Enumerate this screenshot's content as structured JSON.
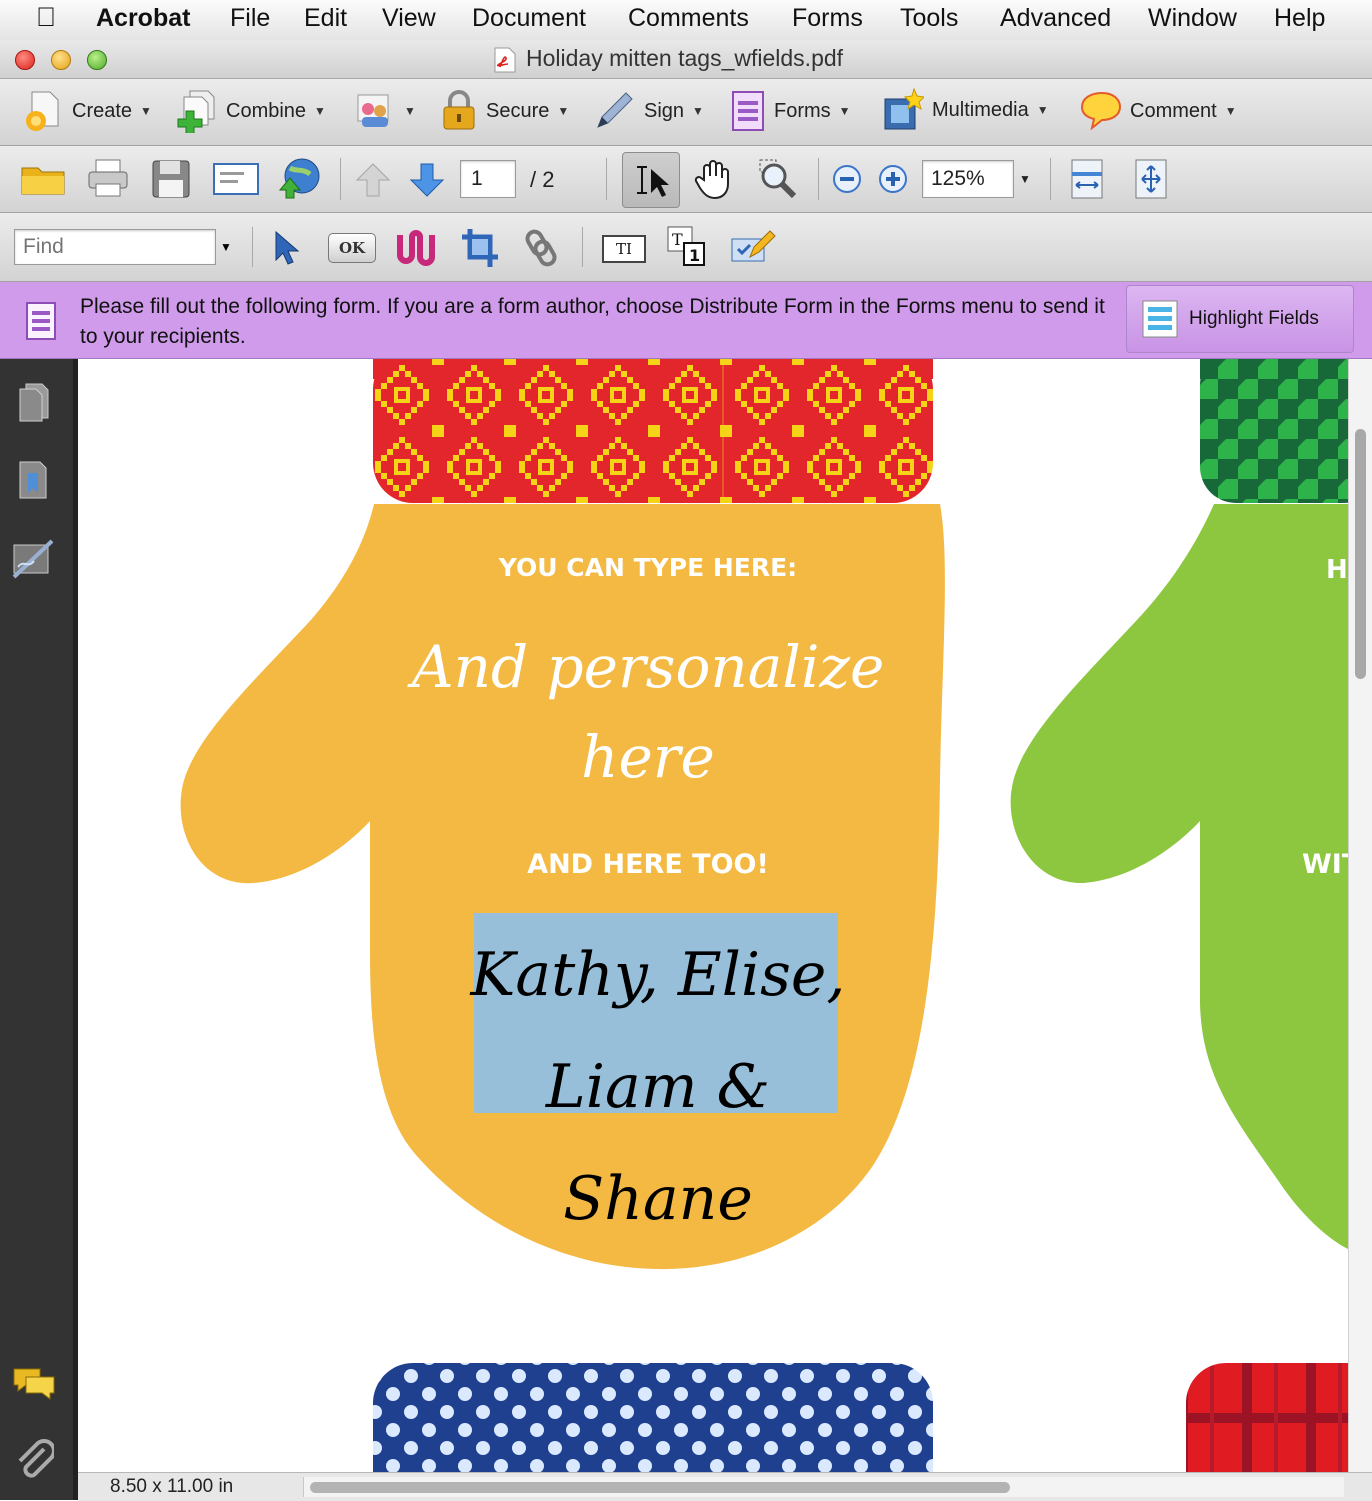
{
  "menubar": {
    "app": "Acrobat",
    "items": [
      "File",
      "Edit",
      "View",
      "Document",
      "Comments",
      "Forms",
      "Tools",
      "Advanced",
      "Window",
      "Help"
    ]
  },
  "window": {
    "title": "Holiday mitten tags_wfields.pdf"
  },
  "tasks_toolbar": {
    "create": "Create",
    "combine": "Combine",
    "secure": "Secure",
    "sign": "Sign",
    "forms": "Forms",
    "multimedia": "Multimedia",
    "comment": "Comment"
  },
  "nav_toolbar": {
    "page_current": "1",
    "page_total": "/ 2",
    "zoom": "125%"
  },
  "find": {
    "placeholder": "Find"
  },
  "edit_toolbar": {
    "ok_label": "OK",
    "text_field_label": "TI"
  },
  "form_bar": {
    "message": "Please fill out the following form. If you are a form author, choose Distribute Form in the Forms menu to send it to your recipients.",
    "highlight_button": "Highlight Fields"
  },
  "document": {
    "mitten_yellow": {
      "heading": "YOU CAN TYPE HERE:",
      "script_line1": "And personalize",
      "script_line2": "here",
      "subheading": "AND HERE TOO!",
      "name_field": "Kathy, Elise, Liam & Shane"
    },
    "mitten_green": {
      "heading_fragment": "H",
      "subheading_fragment": "WIT"
    }
  },
  "status": {
    "page_size": "8.50 x 11.00 in"
  },
  "colors": {
    "form_bar": "#cf9bea",
    "mitten_yellow": "#f4b942",
    "mitten_green": "#8dc63f",
    "cuff_red": "#e3262b",
    "cuff_pattern": "#f5d316",
    "cuff_green": "#1f7a3a",
    "cuff_blue": "#1f3f8f",
    "field_highlight": "#98bfda"
  }
}
